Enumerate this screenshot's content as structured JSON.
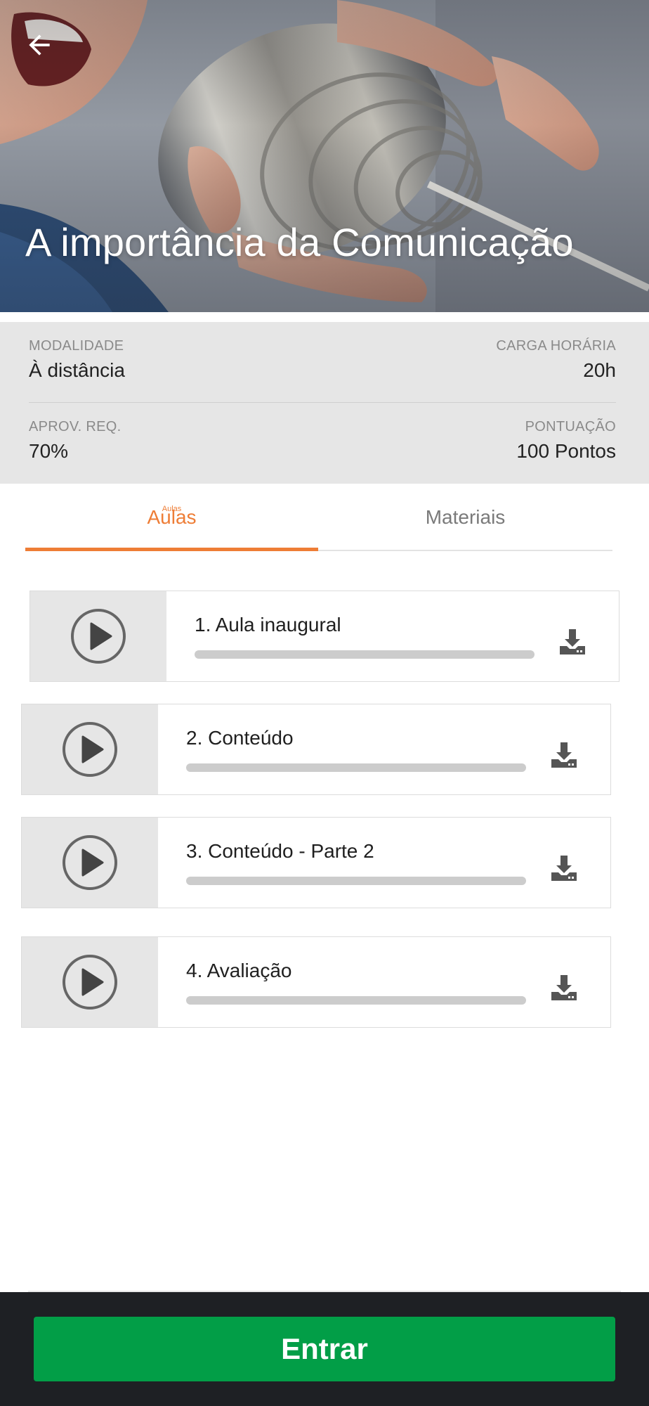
{
  "header": {
    "title": "A importância da Comunicação",
    "back_icon": "arrow-left-icon"
  },
  "info": {
    "modalidade_label": "MODALIDADE",
    "modalidade_value": "À distância",
    "carga_label": "CARGA HORÁRIA",
    "carga_value": "20h",
    "aprov_label": "APROV. REQ.",
    "aprov_value": "70%",
    "pontuacao_label": "PONTUAÇÃO",
    "pontuacao_value": "100 Pontos"
  },
  "tabs": [
    {
      "label": "Aulas",
      "active": true,
      "ghost": "Aulas"
    },
    {
      "label": "Materiais",
      "active": false
    }
  ],
  "lessons": [
    {
      "title": "1. Aula inaugural",
      "progress": 0,
      "icon": "play-circle-icon",
      "action_icon": "download-icon"
    },
    {
      "title": "2. Conteúdo",
      "progress": 0,
      "icon": "play-circle-icon",
      "action_icon": "download-icon"
    },
    {
      "title": "3. Conteúdo - Parte 2",
      "progress": 0,
      "icon": "play-circle-icon",
      "action_icon": "download-icon"
    },
    {
      "title": "4. Avaliação",
      "progress": 0,
      "icon": "play-circle-icon",
      "action_icon": "download-icon"
    }
  ],
  "footer": {
    "enter_label": "Entrar"
  },
  "colors": {
    "accent": "#ee7d36",
    "primary_button": "#029e47",
    "footer_bg": "#1e2024",
    "info_bg": "#e6e6e6"
  }
}
